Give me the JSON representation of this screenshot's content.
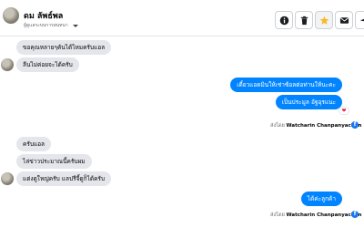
{
  "header": {
    "contact_name": "ดม ลัพธ์พล",
    "status_text": "ผู้ดูแลระบบการสนทนา"
  },
  "actions": {
    "icons": [
      "info-icon",
      "trash-icon",
      "star-icon",
      "mail-icon",
      "send-icon"
    ],
    "star_color": "#f7b928"
  },
  "messages": [
    {
      "direction": "incoming",
      "text": "ขอคุณหลายๆคันได้ไหมครับแอล"
    },
    {
      "direction": "incoming",
      "text": "ลีนไม่ค่อยจะได้ครับ"
    },
    {
      "direction": "outgoing",
      "text": "เดี๋ยวแอดมินให้เช่าซ้อลต่อท่านให้นะคะ"
    },
    {
      "direction": "outgoing",
      "text": "เป็นประมูล อัฐอุรแนะ",
      "reaction": "❤"
    },
    {
      "direction": "incoming",
      "text": "ครับแอล"
    },
    {
      "direction": "incoming",
      "text": "ไล่ข่าวประมาณนี้ครับผม"
    },
    {
      "direction": "incoming",
      "text": "แต่งดูใหญ่ครับ แลปรีจี้ดูก็ได้ครับ"
    },
    {
      "direction": "outgoing",
      "text": "ได้ค่ะลูกค้า"
    }
  ],
  "sent_by": {
    "prefix": "ส่งโดย",
    "name": "Watcharin Chanpanyachon"
  },
  "colors": {
    "outgoing_bubble": "#0084ff",
    "incoming_bubble": "#e4e6eb",
    "heart": "#e41e3f"
  }
}
